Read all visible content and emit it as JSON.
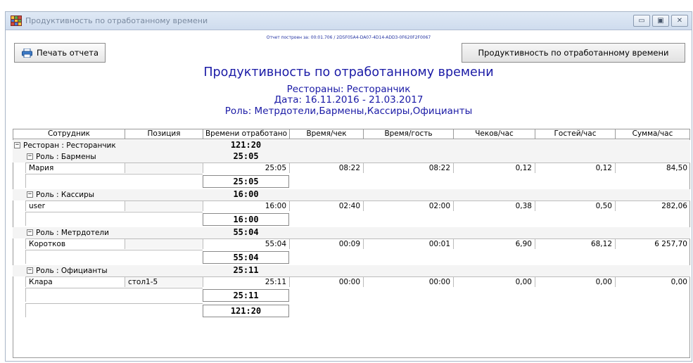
{
  "window": {
    "title": "Продуктивность по отработанному времени",
    "buttons": {
      "minimize": "▭",
      "maximize": "▣",
      "close": "✕"
    }
  },
  "report_info": "Отчет построен за: 00:01.706 / 2D5F05A4-DA07-4D14-ADD3-0F620F2F0067",
  "toolbar": {
    "print_label": "Печать отчета",
    "report_name_label": "Продуктивность по отработанному времени"
  },
  "report": {
    "title": "Продуктивность по отработанному времени",
    "restaurants": "Рестораны: Ресторанчик",
    "date": "Дата: 16.11.2016 - 21.03.2017",
    "roles": "Роль: Метрдотели,Бармены,Кассиры,Официанты"
  },
  "table": {
    "columns": [
      "Сотрудник",
      "Позиция",
      "Времени отработано",
      "Время/чек",
      "Время/гость",
      "Чеков/час",
      "Гостей/час",
      "Сумма/час"
    ],
    "restaurant_group": {
      "label": "Ресторан : Ресторанчик",
      "total": "121:20"
    },
    "roles": [
      {
        "label": "Роль : Бармены",
        "total": "25:05",
        "subtotal": "25:05",
        "rows": [
          {
            "employee": "Мария",
            "position": "",
            "worked": "25:05",
            "time_per_check": "08:22",
            "time_per_guest": "08:22",
            "checks_per_hour": "0,12",
            "guests_per_hour": "0,12",
            "sum_per_hour": "84,50"
          }
        ]
      },
      {
        "label": "Роль : Кассиры",
        "total": "16:00",
        "subtotal": "16:00",
        "rows": [
          {
            "employee": "user",
            "position": "",
            "worked": "16:00",
            "time_per_check": "02:40",
            "time_per_guest": "02:00",
            "checks_per_hour": "0,38",
            "guests_per_hour": "0,50",
            "sum_per_hour": "282,06"
          }
        ]
      },
      {
        "label": "Роль : Метрдотели",
        "total": "55:04",
        "subtotal": "55:04",
        "rows": [
          {
            "employee": "Коротков",
            "position": "",
            "worked": "55:04",
            "time_per_check": "00:09",
            "time_per_guest": "00:01",
            "checks_per_hour": "6,90",
            "guests_per_hour": "68,12",
            "sum_per_hour": "6 257,70"
          }
        ]
      },
      {
        "label": "Роль : Официанты",
        "total": "25:11",
        "subtotal": "25:11",
        "rows": [
          {
            "employee": "Клара",
            "position": "стол1-5",
            "worked": "25:11",
            "time_per_check": "00:00",
            "time_per_guest": "00:00",
            "checks_per_hour": "0,00",
            "guests_per_hour": "0,00",
            "sum_per_hour": "0,00"
          }
        ]
      }
    ],
    "grand_total": "121:20",
    "toggle_symbol": "−"
  },
  "icons": {
    "app": "grid-app-icon",
    "print": "printer-icon"
  },
  "colors": {
    "title_text": "#1a1aa6",
    "titlebar": "#d7e3f3"
  }
}
